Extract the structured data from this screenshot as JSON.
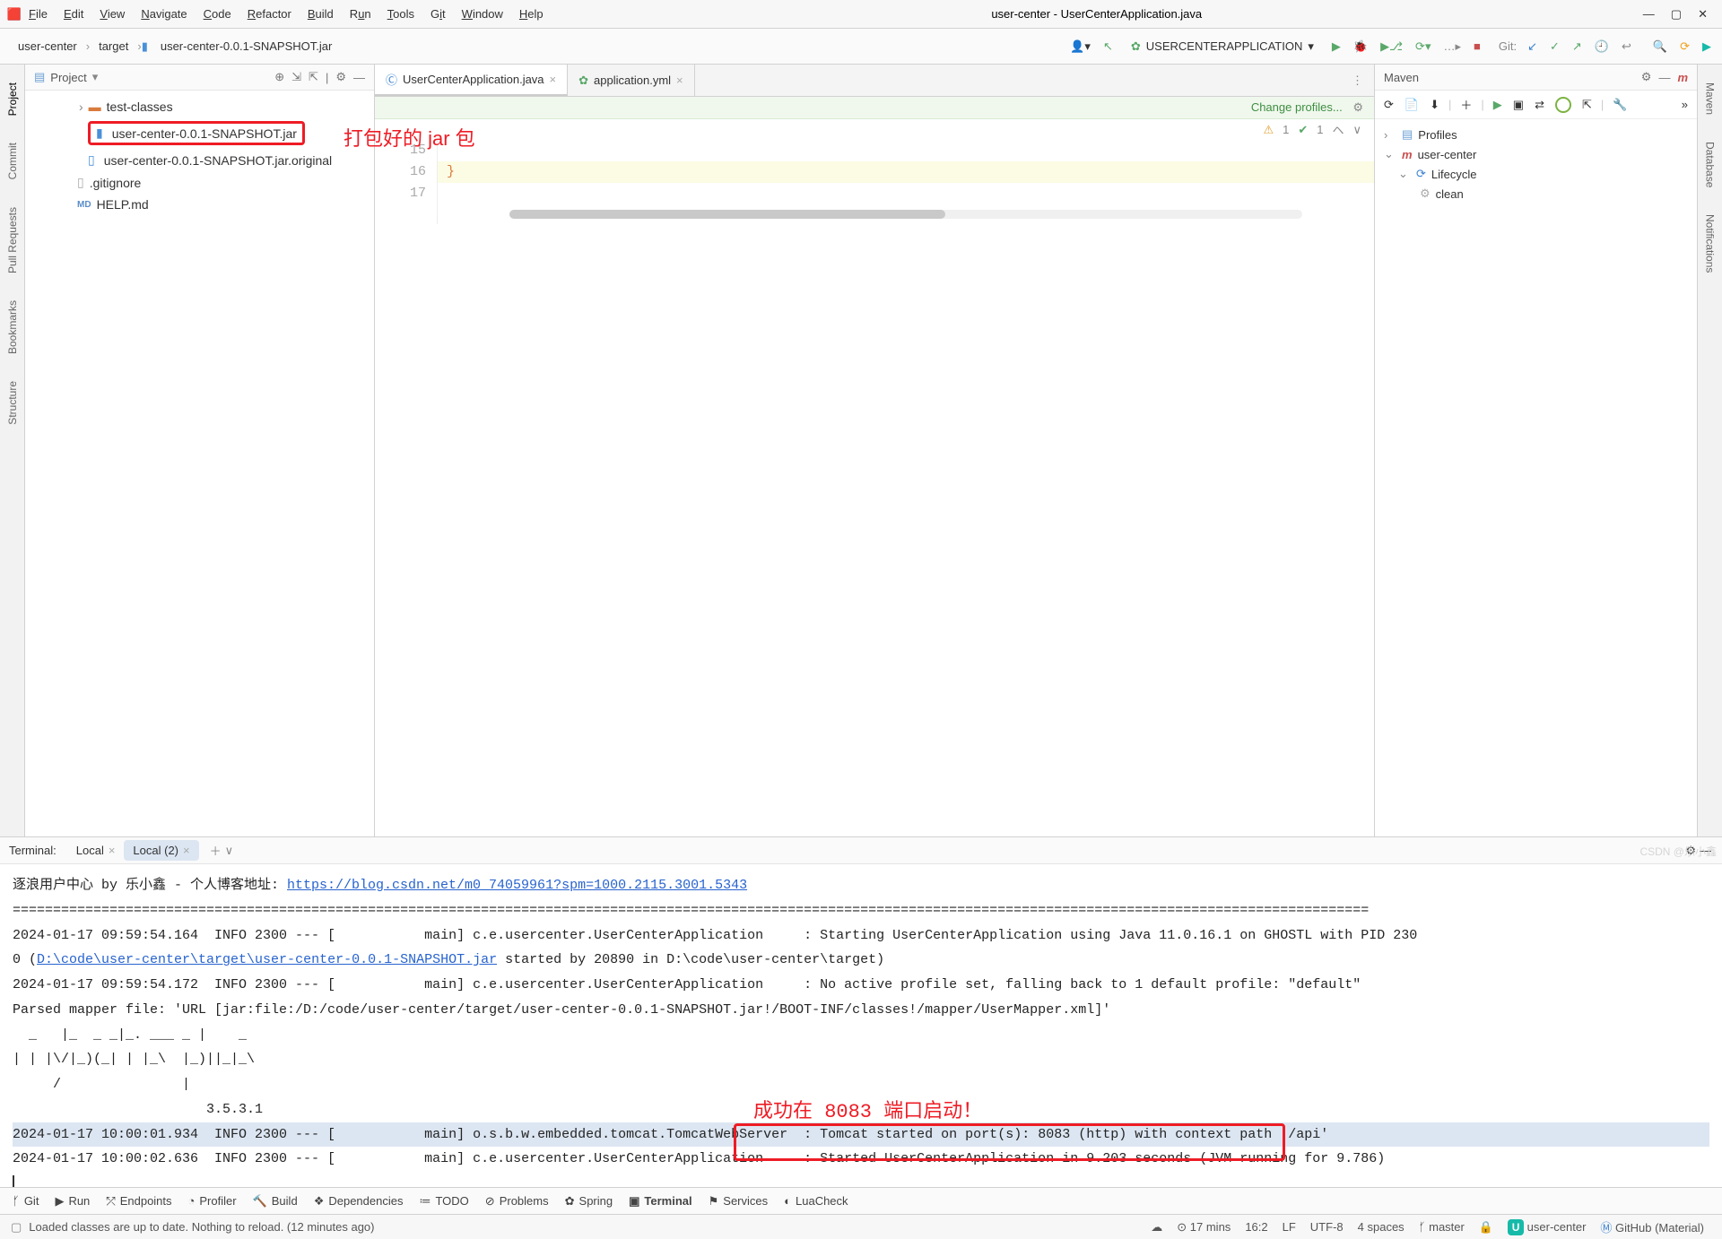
{
  "window_title": "user-center - UserCenterApplication.java",
  "menu": [
    "File",
    "Edit",
    "View",
    "Navigate",
    "Code",
    "Refactor",
    "Build",
    "Run",
    "Tools",
    "Git",
    "Window",
    "Help"
  ],
  "breadcrumb": {
    "p1": "user-center",
    "p2": "target",
    "p3": "user-center-0.0.1-SNAPSHOT.jar"
  },
  "run_config": "USERCENTERAPPLICATION",
  "git_label": "Git:",
  "left_labels": {
    "project": "Project",
    "commit": "Commit",
    "pull": "Pull Requests",
    "bookmarks": "Bookmarks",
    "structure": "Structure"
  },
  "right_labels": {
    "maven": "Maven",
    "database": "Database",
    "notif": "Notifications"
  },
  "project_panel_title": "Project",
  "tree": {
    "r1": "test-classes",
    "r2": "user-center-0.0.1-SNAPSHOT.jar",
    "r3": "user-center-0.0.1-SNAPSHOT.jar.original",
    "r4": ".gitignore",
    "r5": "HELP.md"
  },
  "annot1": "打包好的 jar 包",
  "tabs": {
    "t1": "UserCenterApplication.java",
    "t2": "application.yml"
  },
  "change_profiles": "Change profiles...",
  "errband": {
    "warn": "1",
    "ok": "1"
  },
  "gutter": {
    "l15": "15",
    "l16": "16",
    "l17": "17"
  },
  "code_brace": "}",
  "maven_title": "Maven",
  "maven": {
    "profiles": "Profiles",
    "root": "user-center",
    "lifecycle": "Lifecycle",
    "clean": "clean"
  },
  "terminal": {
    "title": "Terminal:",
    "tab1": "Local",
    "tab2": "Local (2)",
    "intro": "逐浪用户中心 by 乐小鑫 - 个人博客地址: ",
    "url": "https://blog.csdn.net/m0_74059961?spm=1000.2115.3001.5343",
    "sep": "========================================================================================================================================================================",
    "l1a": "2024-01-17 09:59:54.164  INFO 2300 --- [           main] c.e.usercenter.UserCenterApplication     : Starting UserCenterApplication using Java 11.0.16.1 on GHOSTL with PID 230",
    "l1b": "0 (",
    "l1c": "D:\\code\\user-center\\target\\user-center-0.0.1-SNAPSHOT.jar",
    "l1d": " started by 20890 in D:\\code\\user-center\\target)",
    "l2": "2024-01-17 09:59:54.172  INFO 2300 --- [           main] c.e.usercenter.UserCenterApplication     : No active profile set, falling back to 1 default profile: \"default\"",
    "l3": "Parsed mapper file: 'URL [jar:file:/D:/code/user-center/target/user-center-0.0.1-SNAPSHOT.jar!/BOOT-INF/classes!/mapper/UserMapper.xml]'",
    "art1": "  _   |_  _ _|_. ___ _ |    _",
    "art2": "| | |\\/|_)(_| | |_\\  |_)||_|_\\",
    "art3": "     /               |",
    "ver": "                        3.5.3.1",
    "l4a": "2024-01-17 10:00:01.934  INFO 2300 --- [           main] o.s.b.w.embedded.tomcat.TomcatWebServer  : ",
    "l4b": "Tomcat started on port(s): 8083 (http) with context path '/api'",
    "l5": "2024-01-17 10:00:02.636  INFO 2300 --- [           main] c.e.usercenter.UserCenterApplication     : Started UserCenterApplication in 9.203 seconds (JVM running for 9.786)"
  },
  "annot2": "成功在 8083 端口启动！",
  "bottom_tools": {
    "git": "Git",
    "run": "Run",
    "endpoints": "Endpoints",
    "profiler": "Profiler",
    "build": "Build",
    "deps": "Dependencies",
    "todo": "TODO",
    "problems": "Problems",
    "spring": "Spring",
    "terminal": "Terminal",
    "services": "Services",
    "lua": "LuaCheck"
  },
  "status": {
    "msg": "Loaded classes are up to date. Nothing to reload. (12 minutes ago)",
    "time": "17 mins",
    "pos": "16:2",
    "lf": "LF",
    "enc": "UTF-8",
    "indent": "4 spaces",
    "branch": "master",
    "project": "user-center",
    "theme": "GitHub (Material)"
  },
  "watermark": "CSDN @乐小鑫"
}
